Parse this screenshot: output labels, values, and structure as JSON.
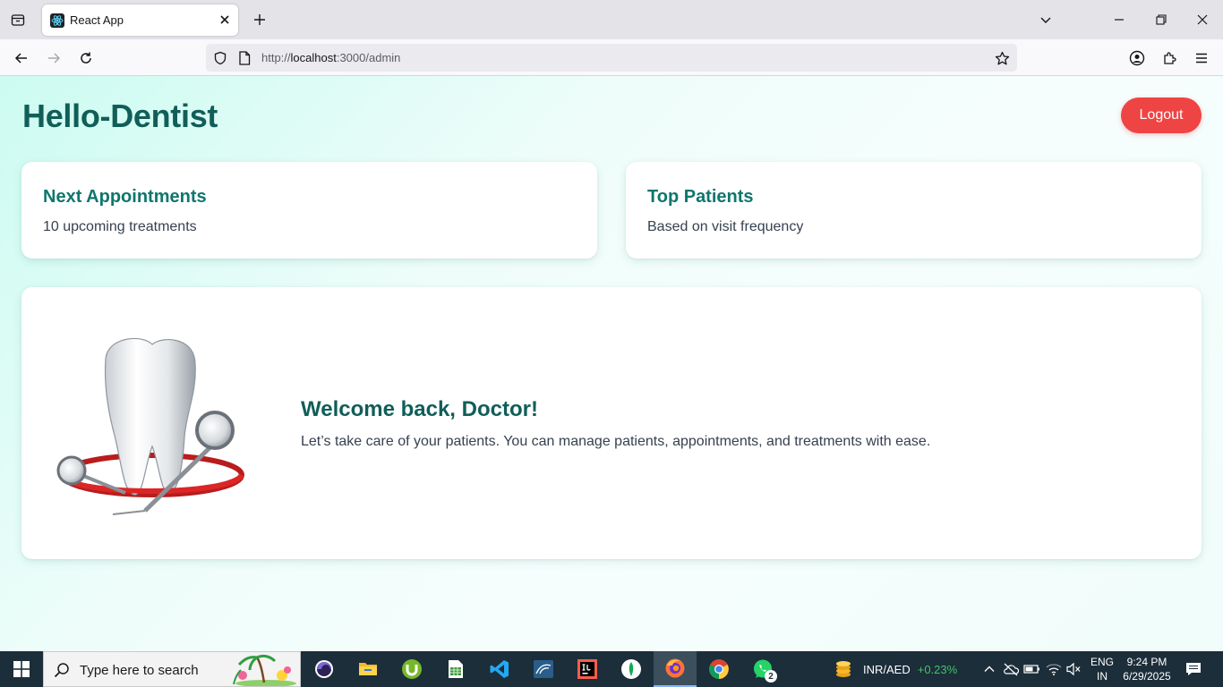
{
  "browser": {
    "tab": {
      "title": "React App",
      "favicon": "react-icon"
    },
    "url": {
      "scheme": "http://",
      "host": "localhost",
      "path": ":3000/admin"
    }
  },
  "app": {
    "title": "Hello-Dentist",
    "logout_label": "Logout",
    "cards": [
      {
        "title": "Next Appointments",
        "subtitle": "10 upcoming treatments"
      },
      {
        "title": "Top Patients",
        "subtitle": "Based on visit frequency"
      }
    ],
    "welcome": {
      "title": "Welcome back, Doctor!",
      "text": "Let’s take care of your patients. You can manage patients, appointments, and treatments with ease.",
      "image": "tooth-with-dental-tools"
    },
    "colors": {
      "accent": "#115e59",
      "card_title": "#0f766e",
      "logout": "#ef4444"
    }
  },
  "taskbar": {
    "search_placeholder": "Type here to search",
    "apps": [
      "eclipse-icon",
      "file-explorer-icon",
      "utorrent-icon",
      "spreadsheet-icon",
      "vscode-icon",
      "mysql-workbench-icon",
      "intellij-icon",
      "mongodb-compass-icon",
      "firefox-icon",
      "chrome-icon",
      "whatsapp-icon"
    ],
    "whatsapp_badge": "2",
    "ticker": {
      "pair": "INR/AED",
      "change": "+0.23%"
    },
    "language": {
      "line1": "ENG",
      "line2": "IN"
    },
    "clock": {
      "time": "9:24 PM",
      "date": "6/29/2025"
    }
  }
}
